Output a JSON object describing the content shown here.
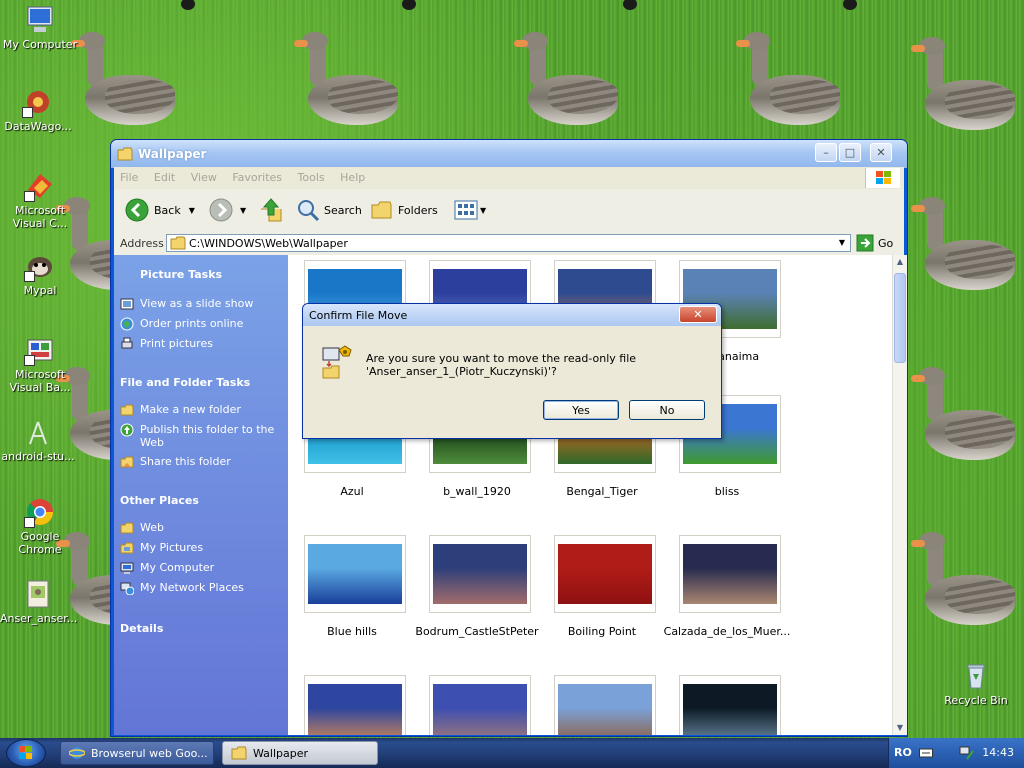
{
  "desktop": {
    "icons": [
      {
        "label": "My Computer"
      },
      {
        "label": "DataWago..."
      },
      {
        "label": "Microsoft Visual C..."
      },
      {
        "label": "Mypal"
      },
      {
        "label": "Microsoft Visual Ba..."
      },
      {
        "label": "android-stu..."
      },
      {
        "label": "Google Chrome"
      },
      {
        "label": "Anser_anser..."
      },
      {
        "label": "Recycle Bin"
      }
    ]
  },
  "window": {
    "title": "Wallpaper",
    "menu": [
      "File",
      "Edit",
      "View",
      "Favorites",
      "Tools",
      "Help"
    ],
    "toolbar": {
      "back": "Back",
      "search": "Search",
      "folders": "Folders"
    },
    "address": {
      "label": "Address",
      "value": "C:\\WINDOWS\\Web\\Wallpaper",
      "go": "Go"
    },
    "taskpane": {
      "picture_tasks": {
        "title": "Picture Tasks",
        "items": [
          "View as a slide show",
          "Order prints online",
          "Print pictures"
        ]
      },
      "file_tasks": {
        "title": "File and Folder Tasks",
        "items": [
          "Make a new folder",
          "Publish this folder to the Web",
          "Share this folder"
        ]
      },
      "other_places": {
        "title": "Other Places",
        "items": [
          "Web",
          "My Pictures",
          "My Computer",
          "My Network Places"
        ]
      },
      "details": {
        "title": "Details"
      }
    },
    "thumbnails": [
      {
        "caption": "",
        "colors": [
          "#1a77c8",
          "#5ab4ea"
        ]
      },
      {
        "caption": "",
        "colors": [
          "#2c3f9c",
          "#6d86d6"
        ]
      },
      {
        "caption": "",
        "colors": [
          "#2e4b8f",
          "#c87a4a"
        ]
      },
      {
        "caption": "ui_Canaima",
        "colors": [
          "#5b82b6",
          "#3f6e2f"
        ]
      },
      {
        "caption": "Azul",
        "colors": [
          "#1695c9",
          "#40c1e6"
        ]
      },
      {
        "caption": "b_wall_1920",
        "colors": [
          "#133d16",
          "#4f8c3a"
        ]
      },
      {
        "caption": "Bengal_Tiger",
        "colors": [
          "#c06421",
          "#2f6a2a"
        ]
      },
      {
        "caption": "bliss",
        "colors": [
          "#3b76d3",
          "#3f9a2e"
        ]
      },
      {
        "caption": "Blue hills",
        "colors": [
          "#5aa9e1",
          "#1a3f9a"
        ]
      },
      {
        "caption": "Bodrum_CastleStPeter",
        "colors": [
          "#2d3f7a",
          "#a26d6b"
        ]
      },
      {
        "caption": "Boiling Point",
        "colors": [
          "#b01c17",
          "#8e1111"
        ]
      },
      {
        "caption": "Calzada_de_los_Muer...",
        "colors": [
          "#272b4f",
          "#a98670"
        ]
      },
      {
        "caption": "",
        "colors": [
          "#2e46a0",
          "#d78a52"
        ]
      },
      {
        "caption": "",
        "colors": [
          "#3d4fb0",
          "#a77a74"
        ]
      },
      {
        "caption": "",
        "colors": [
          "#7aa1d8",
          "#8f5e3f"
        ]
      },
      {
        "caption": "",
        "colors": [
          "#0d1a26",
          "#6e8ea6"
        ]
      }
    ]
  },
  "dialog": {
    "title": "Confirm File Move",
    "message": "Are you sure you want to move the read-only file 'Anser_anser_1_(Piotr_Kuczynski)'?",
    "yes": "Yes",
    "no": "No"
  },
  "taskbar": {
    "tasks": [
      {
        "label": "Browserul web Goo...",
        "active": false
      },
      {
        "label": "Wallpaper",
        "active": true
      }
    ],
    "language": "RO",
    "clock": "14:43"
  }
}
